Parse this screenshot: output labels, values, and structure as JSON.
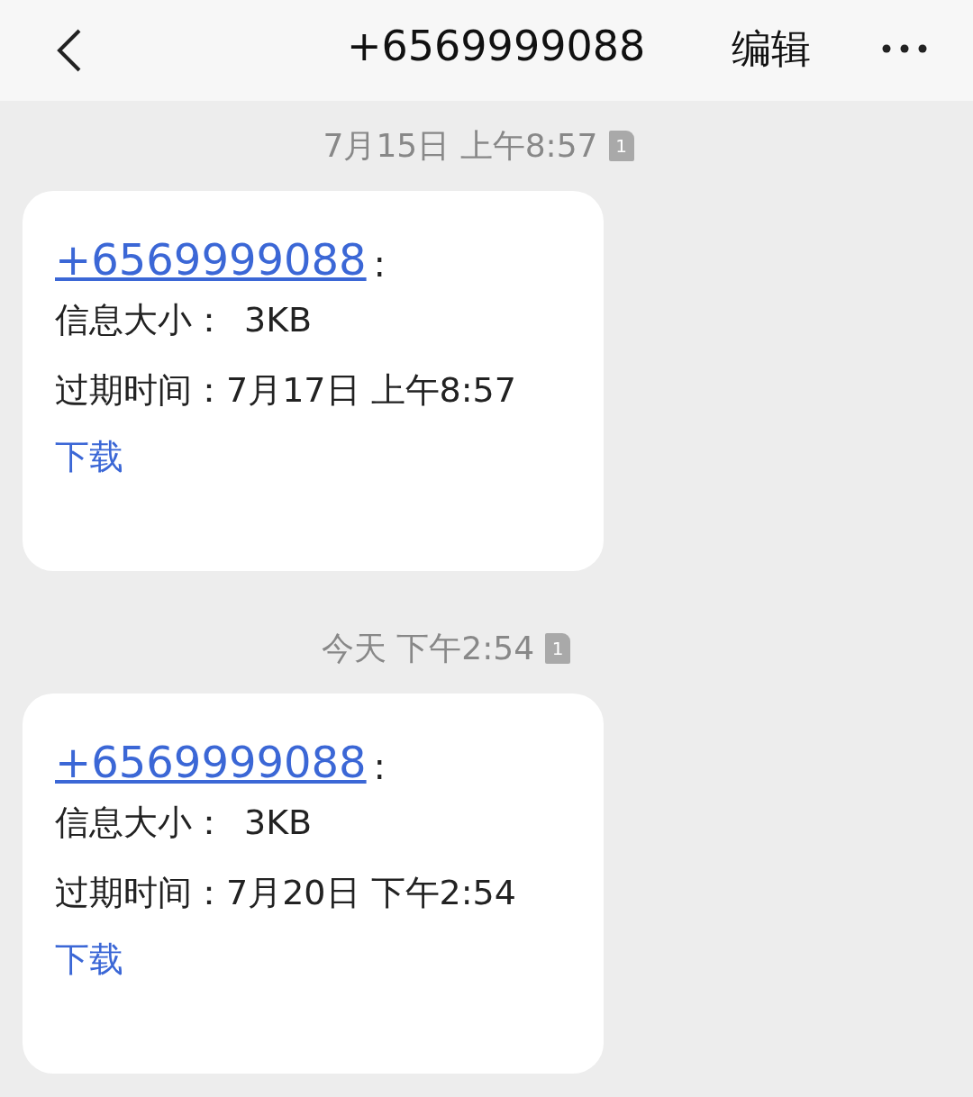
{
  "header": {
    "title": "+6569999088",
    "edit": "编辑"
  },
  "messages": [
    {
      "timestamp": "7月15日 上午8:57",
      "sim": "1",
      "sender": "+6569999088",
      "colon": ":",
      "size_label": "信息大小：",
      "size": "3KB",
      "expiry_label": "过期时间：",
      "expiry": "7月17日 上午8:57",
      "download": "下载"
    },
    {
      "timestamp": "今天 下午2:54",
      "sim": "1",
      "sender": "+6569999088",
      "colon": ":",
      "size_label": "信息大小：",
      "size": "3KB",
      "expiry_label": "过期时间：",
      "expiry": "7月20日 下午2:54",
      "download": "下载"
    }
  ]
}
